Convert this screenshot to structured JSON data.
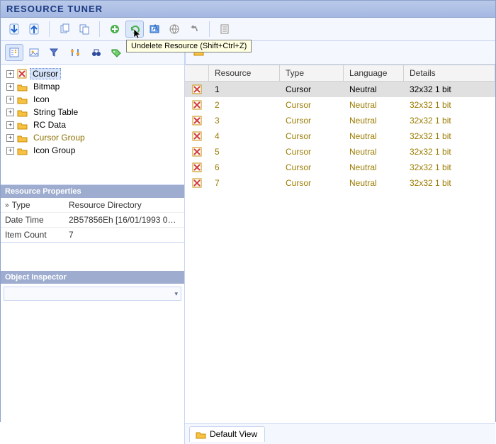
{
  "title": "RESOURCE TUNER",
  "tooltip": "Undelete Resource (Shift+Ctrl+Z)",
  "tree": [
    {
      "label": "Cursor",
      "icon": "x",
      "selected": true,
      "deleted": false
    },
    {
      "label": "Bitmap",
      "icon": "folder"
    },
    {
      "label": "Icon",
      "icon": "folder"
    },
    {
      "label": "String Table",
      "icon": "folder"
    },
    {
      "label": "RC Data",
      "icon": "folder"
    },
    {
      "label": "Cursor Group",
      "icon": "folder",
      "deleted": true
    },
    {
      "label": "Icon Group",
      "icon": "folder"
    }
  ],
  "props_header": "Resource Properties",
  "props": [
    {
      "key": "Type",
      "val": "Resource Directory",
      "chev": true
    },
    {
      "key": "Date Time",
      "val": "2B57856Eh  [16/01/1993 03:47..."
    },
    {
      "key": "Item Count",
      "val": "7"
    }
  ],
  "obj_header": "Object Inspector",
  "grid": {
    "cols": [
      "",
      "Resource",
      "Type",
      "Language",
      "Details"
    ],
    "rows": [
      {
        "r": "1",
        "t": "Cursor",
        "l": "Neutral",
        "d": "32x32 1 bit",
        "sel": true,
        "del": false
      },
      {
        "r": "2",
        "t": "Cursor",
        "l": "Neutral",
        "d": "32x32 1 bit",
        "del": true
      },
      {
        "r": "3",
        "t": "Cursor",
        "l": "Neutral",
        "d": "32x32 1 bit",
        "del": true
      },
      {
        "r": "4",
        "t": "Cursor",
        "l": "Neutral",
        "d": "32x32 1 bit",
        "del": true
      },
      {
        "r": "5",
        "t": "Cursor",
        "l": "Neutral",
        "d": "32x32 1 bit",
        "del": true
      },
      {
        "r": "6",
        "t": "Cursor",
        "l": "Neutral",
        "d": "32x32 1 bit",
        "del": true
      },
      {
        "r": "7",
        "t": "Cursor",
        "l": "Neutral",
        "d": "32x32 1 bit",
        "del": true
      }
    ]
  },
  "tab_label": "Default View"
}
